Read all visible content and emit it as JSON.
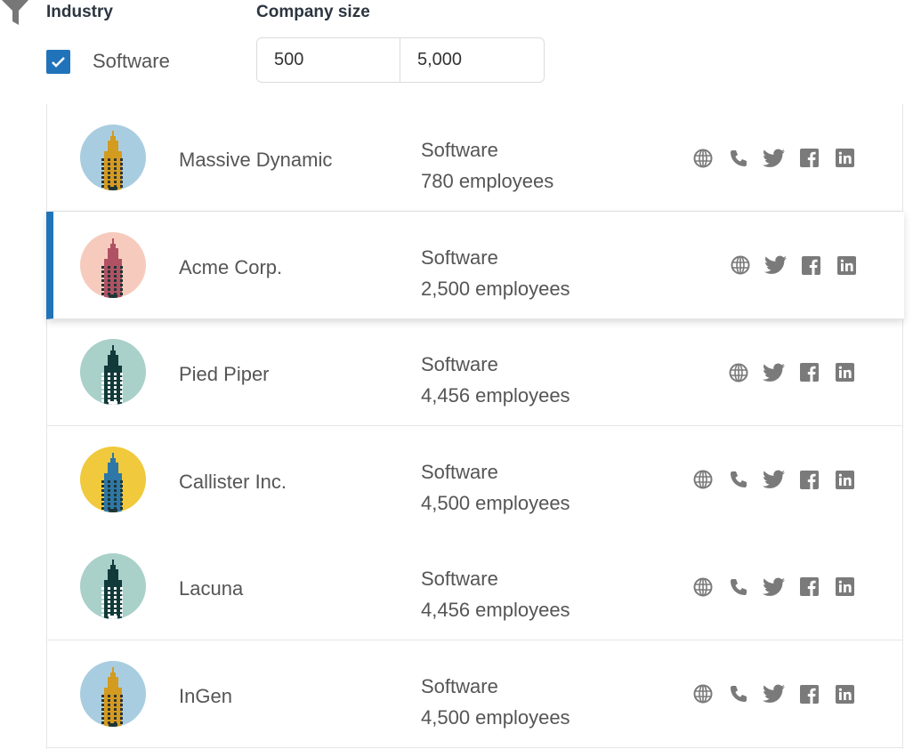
{
  "filters": {
    "industry_label": "Industry",
    "size_label": "Company size",
    "industry_option": "Software",
    "industry_checked": true,
    "size_min": "500",
    "size_max": "5,000"
  },
  "accent": "#2173b9",
  "companies": [
    {
      "name": "Massive Dynamic",
      "industry": "Software",
      "employees": "780 employees",
      "bg": "#a9cde0",
      "building": "#d39b1f",
      "windows": "#333",
      "phone": true
    },
    {
      "name": "Acme Corp.",
      "industry": "Software",
      "employees": "2,500 employees",
      "bg": "#f6cbbd",
      "building": "#b05264",
      "windows": "#1d3535",
      "phone": false,
      "selected": true
    },
    {
      "name": "Pied Piper",
      "industry": "Software",
      "employees": "4,456 employees",
      "bg": "#a9d0c9",
      "building": "#123a3a",
      "windows": "#ffffff",
      "phone": false
    },
    {
      "name": "Callister Inc.",
      "industry": "Software",
      "employees": "4,500 employees",
      "bg": "#f0c93c",
      "building": "#2e77a6",
      "windows": "#1d3535",
      "phone": true
    },
    {
      "name": "Lacuna",
      "industry": "Software",
      "employees": "4,456 employees",
      "bg": "#a9d0c9",
      "building": "#123a3a",
      "windows": "#ffffff",
      "phone": true
    },
    {
      "name": "InGen",
      "industry": "Software",
      "employees": "4,500 employees",
      "bg": "#a9cde0",
      "building": "#d39b1f",
      "windows": "#333",
      "phone": true
    }
  ]
}
